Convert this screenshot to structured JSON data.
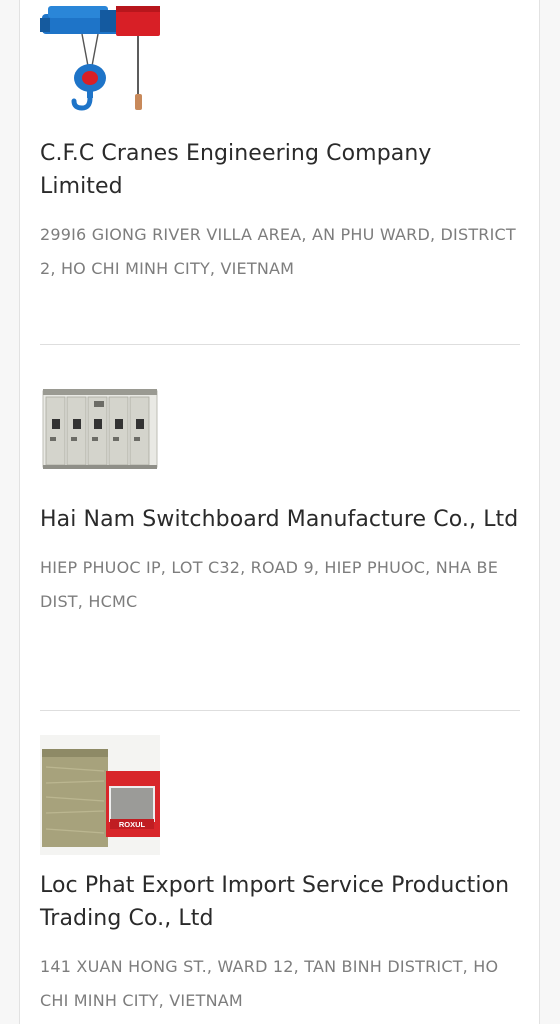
{
  "companies": [
    {
      "name": "C.F.C Cranes Engineering Company Limited",
      "address": "299I6 GIONG RIVER VILLA AREA, AN PHU WARD, DISTRICT 2, HO CHI MINH CITY, VIETNAM",
      "image_icon": "crane-hoist-icon"
    },
    {
      "name": "Hai Nam Switchboard Manufacture Co., Ltd",
      "address": "HIEP PHUOC IP, LOT C32, ROAD 9, HIEP PHUOC, NHA BE DIST, HCMC",
      "image_icon": "switchboard-cabinet-icon"
    },
    {
      "name": "Loc Phat Export Import Service Production Trading Co., Ltd",
      "address": "141 XUAN HONG ST., WARD 12, TAN BINH DISTRICT, HO CHI MINH CITY, VIETNAM",
      "image_icon": "insulation-product-icon",
      "product_label": "ROXUL"
    }
  ]
}
